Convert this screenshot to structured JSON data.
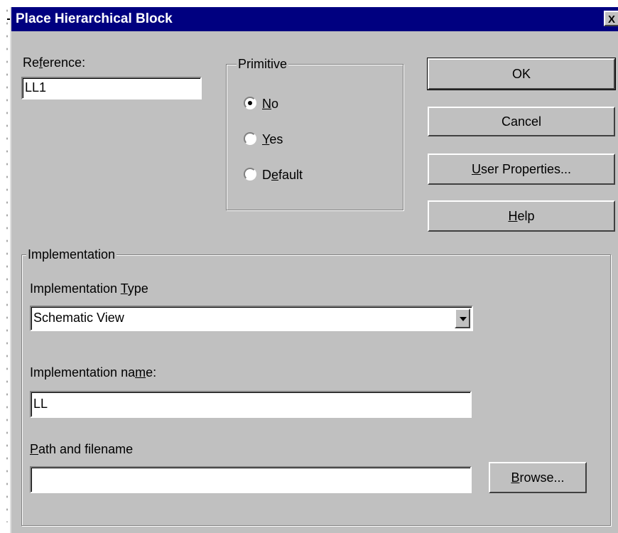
{
  "window": {
    "title": "Place Hierarchical Block",
    "close_glyph": "X"
  },
  "reference": {
    "label_pre": "Re",
    "label_u": "f",
    "label_post": "erence:",
    "value": "LL1"
  },
  "primitive": {
    "legend": "Primitive",
    "options": [
      {
        "pre": "",
        "u": "N",
        "post": "o",
        "selected": true
      },
      {
        "pre": "",
        "u": "Y",
        "post": "es",
        "selected": false
      },
      {
        "pre": "D",
        "u": "e",
        "post": "fault",
        "selected": false
      }
    ]
  },
  "buttons": {
    "ok": "OK",
    "cancel": "Cancel",
    "user_props": {
      "u": "U",
      "post": "ser Properties..."
    },
    "help": {
      "u": "H",
      "post": "elp"
    },
    "browse": {
      "u": "B",
      "post": "rowse..."
    }
  },
  "implementation": {
    "legend": "Implementation",
    "type_label": {
      "pre": "Implementation ",
      "u": "T",
      "post": "ype"
    },
    "type_value": "Schematic View",
    "name_label": {
      "pre": "Implementation na",
      "u": "m",
      "post": "e:"
    },
    "name_value": "LL",
    "path_label": {
      "pre": "",
      "u": "P",
      "post": "ath and filename"
    },
    "path_value": ""
  },
  "icons": {
    "close": "close-icon",
    "dropdown": "chevron-down-icon",
    "radio": "radio-icon"
  }
}
